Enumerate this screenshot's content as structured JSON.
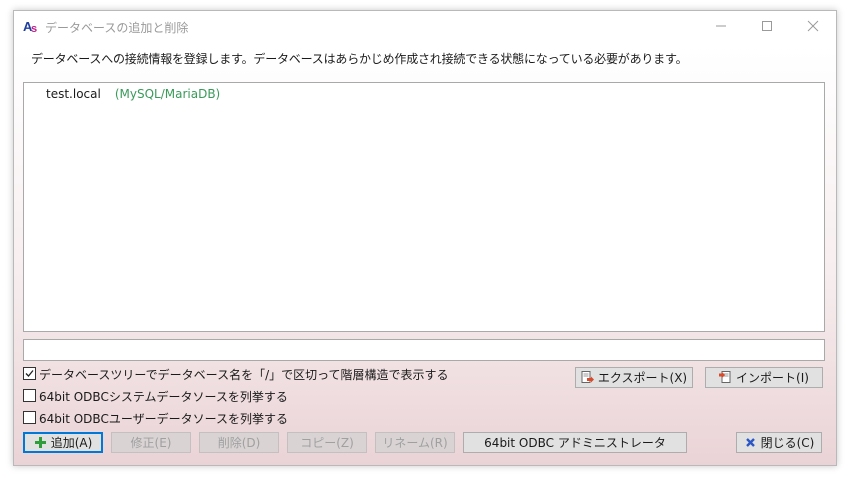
{
  "window": {
    "title": "データベースの追加と削除",
    "app_icon": "as-logo-icon",
    "controls": [
      "minimize-icon",
      "maximize-icon",
      "close-icon"
    ]
  },
  "description": "データベースへの接続情報を登録します。データベースはあらかじめ作成され接続できる状態になっている必要があります。",
  "databases": [
    {
      "name": "test.local",
      "type": "(MySQL/MariaDB)"
    }
  ],
  "input": {
    "value": ""
  },
  "options": [
    {
      "label": "データベースツリーでデータベース名を「/」で区切って階層構造で表示する",
      "checked": true
    },
    {
      "label": "64bit ODBCシステムデータソースを列挙する",
      "checked": false
    },
    {
      "label": "64bit ODBCユーザーデータソースを列挙する",
      "checked": false
    }
  ],
  "buttons": {
    "export": "エクスポート(X)",
    "import": "インポート(I)",
    "add": "追加(A)",
    "modify": "修正(E)",
    "delete": "削除(D)",
    "copy": "コピー(Z)",
    "rename": "リネーム(R)",
    "odbc_admin": "64bit ODBC アドミニストレータ",
    "close": "閉じる(C)"
  },
  "colors": {
    "accent": "#0078d7",
    "db_type": "#3a9a5a",
    "add_icon": "#2e9e3a",
    "close_icon": "#2a56c6",
    "io_icon": "#d94a2a"
  }
}
